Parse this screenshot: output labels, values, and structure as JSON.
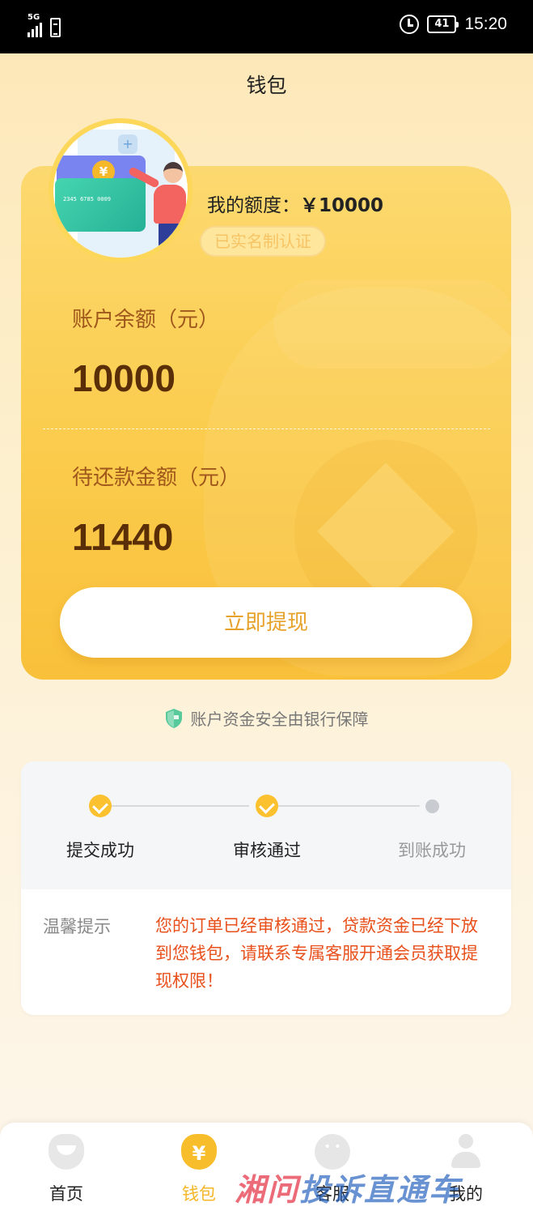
{
  "status_bar": {
    "network": "5G",
    "battery": "41",
    "time": "15:20"
  },
  "header": {
    "title": "钱包"
  },
  "wallet": {
    "quota_label": "我的额度：",
    "quota_amount": "￥10000",
    "verified_badge": "已实名制认证",
    "balance_label": "账户余额（元）",
    "balance_value": "10000",
    "repay_label": "待还款金额（元）",
    "repay_value": "11440",
    "withdraw_button": "立即提现",
    "illustration_card_number": "2345 6785 0009",
    "illustration_coin": "¥"
  },
  "safety_note": "账户资金安全由银行保障",
  "progress": {
    "steps": [
      {
        "label": "提交成功",
        "status": "done"
      },
      {
        "label": "审核通过",
        "status": "done"
      },
      {
        "label": "到账成功",
        "status": "pending"
      }
    ]
  },
  "tip": {
    "title": "温馨提示",
    "text": "您的订单已经审核通过，贷款资金已经下放到您钱包，请联系专属客服开通会员获取提现权限！"
  },
  "bottom_nav": {
    "items": [
      {
        "label": "首页",
        "icon": "home-icon",
        "active": false
      },
      {
        "label": "钱包",
        "icon": "wallet-icon",
        "active": true
      },
      {
        "label": "客服",
        "icon": "chat-icon",
        "active": false
      },
      {
        "label": "我的",
        "icon": "user-icon",
        "active": false
      }
    ]
  },
  "watermark": {
    "part1": "湘问",
    "part2": "投诉直通车"
  },
  "colors": {
    "accent": "#fbc12f",
    "alert_text": "#e8501c",
    "card_label": "#a0571c",
    "card_value": "#5a2f08"
  }
}
